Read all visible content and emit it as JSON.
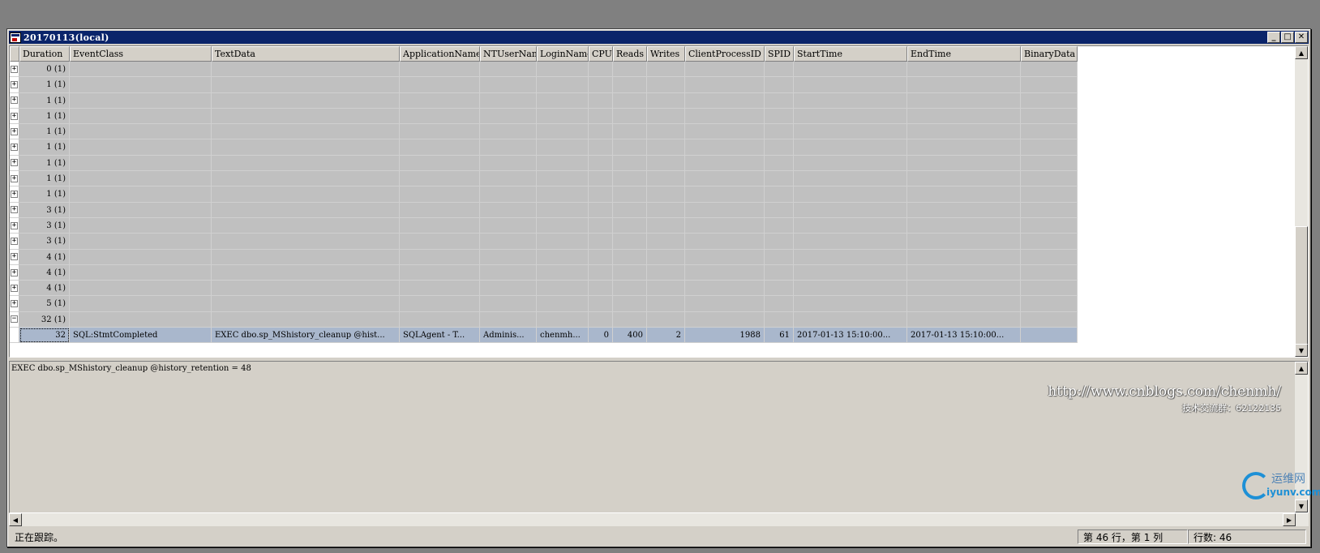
{
  "window": {
    "title": "20170113(local)",
    "controls": [
      "_",
      "□",
      "✕"
    ]
  },
  "grid": {
    "columns": [
      {
        "key": "exp",
        "label": ""
      },
      {
        "key": "Duration",
        "label": "Duration"
      },
      {
        "key": "EventClass",
        "label": "EventClass"
      },
      {
        "key": "TextData",
        "label": "TextData"
      },
      {
        "key": "ApplicationName",
        "label": "ApplicationName"
      },
      {
        "key": "NTUserName",
        "label": "NTUserName"
      },
      {
        "key": "LoginName",
        "label": "LoginName"
      },
      {
        "key": "CPU",
        "label": "CPU"
      },
      {
        "key": "Reads",
        "label": "Reads"
      },
      {
        "key": "Writes",
        "label": "Writes"
      },
      {
        "key": "ClientProcessID",
        "label": "ClientProcessID"
      },
      {
        "key": "SPID",
        "label": "SPID"
      },
      {
        "key": "StartTime",
        "label": "StartTime"
      },
      {
        "key": "EndTime",
        "label": "EndTime"
      },
      {
        "key": "BinaryData",
        "label": "BinaryData"
      }
    ],
    "groups": [
      {
        "expander": "+",
        "duration": "0 (1)"
      },
      {
        "expander": "+",
        "duration": "1 (1)"
      },
      {
        "expander": "+",
        "duration": "1 (1)"
      },
      {
        "expander": "+",
        "duration": "1 (1)"
      },
      {
        "expander": "+",
        "duration": "1 (1)"
      },
      {
        "expander": "+",
        "duration": "1 (1)"
      },
      {
        "expander": "+",
        "duration": "1 (1)"
      },
      {
        "expander": "+",
        "duration": "1 (1)"
      },
      {
        "expander": "+",
        "duration": "1 (1)"
      },
      {
        "expander": "+",
        "duration": "3 (1)"
      },
      {
        "expander": "+",
        "duration": "3 (1)"
      },
      {
        "expander": "+",
        "duration": "3 (1)"
      },
      {
        "expander": "+",
        "duration": "4 (1)"
      },
      {
        "expander": "+",
        "duration": "4 (1)"
      },
      {
        "expander": "+",
        "duration": "4 (1)"
      },
      {
        "expander": "+",
        "duration": "5 (1)"
      },
      {
        "expander": "−",
        "duration": "32 (1)"
      }
    ],
    "selected_row": {
      "Duration": "32",
      "EventClass": "SQL:StmtCompleted",
      "TextData": "EXEC dbo.sp_MShistory_cleanup @hist...",
      "ApplicationName": "SQLAgent - T...",
      "NTUserName": "Adminis...",
      "LoginName": "chenmh...",
      "CPU": "0",
      "Reads": "400",
      "Writes": "2",
      "ClientProcessID": "1988",
      "SPID": "61",
      "StartTime": "2017-01-13 15:10:00...",
      "EndTime": "2017-01-13 15:10:00...",
      "BinaryData": ""
    }
  },
  "detail": {
    "text": "EXEC dbo.sp_MShistory_cleanup @history_retention = 48"
  },
  "watermark": {
    "url": "http://www.cnblogs.com/chenmh/",
    "group": "技术交流群：62122135"
  },
  "statusbar": {
    "message": "正在跟踪。",
    "position": "第 46 行，第 1 列",
    "rows": "行数: 46"
  },
  "logo": {
    "cn": "运维网",
    "en": "iyunv.com"
  }
}
